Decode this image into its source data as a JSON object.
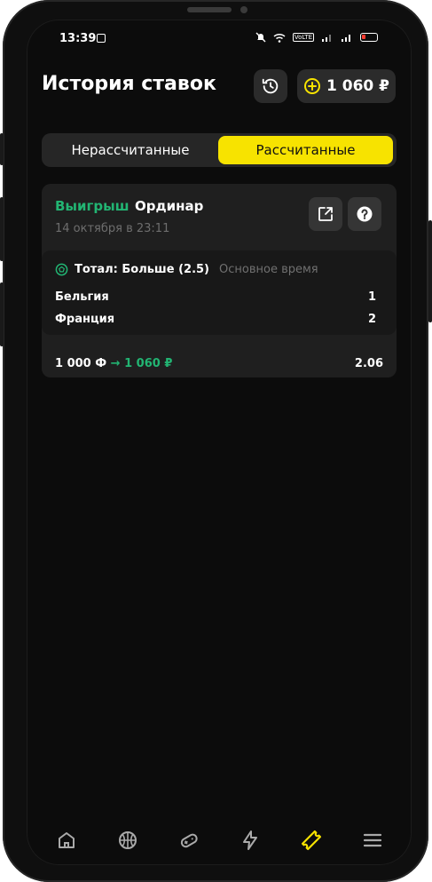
{
  "status_bar": {
    "time": "13:39",
    "volte": "VoLTE"
  },
  "header": {
    "title": "История ставок",
    "balance": "1 060 ₽"
  },
  "tabs": [
    {
      "label": "Нерассчитанные",
      "active": false
    },
    {
      "label": "Рассчитанные",
      "active": true
    }
  ],
  "bet": {
    "result": "Выигрыш",
    "type": "Ординар",
    "date": "14 октября в 23:11",
    "market": "Тотал: Больше (2.5)",
    "period": "Основное время",
    "teams": [
      {
        "name": "Бельгия",
        "score": "1"
      },
      {
        "name": "Франция",
        "score": "2"
      }
    ],
    "stake": "1 000 Ф",
    "arrow": "→",
    "payout": "1 060 ₽",
    "odds": "2.06"
  },
  "bottom_nav": [
    {
      "icon": "home-icon"
    },
    {
      "icon": "basketball-icon"
    },
    {
      "icon": "gamepad-icon"
    },
    {
      "icon": "lightning-icon"
    },
    {
      "icon": "ticket-icon",
      "active": true
    },
    {
      "icon": "menu-icon"
    }
  ],
  "colors": {
    "accent": "#f7e300",
    "win": "#22b573",
    "background": "#0c0c0c",
    "card": "#1f1f1f"
  }
}
